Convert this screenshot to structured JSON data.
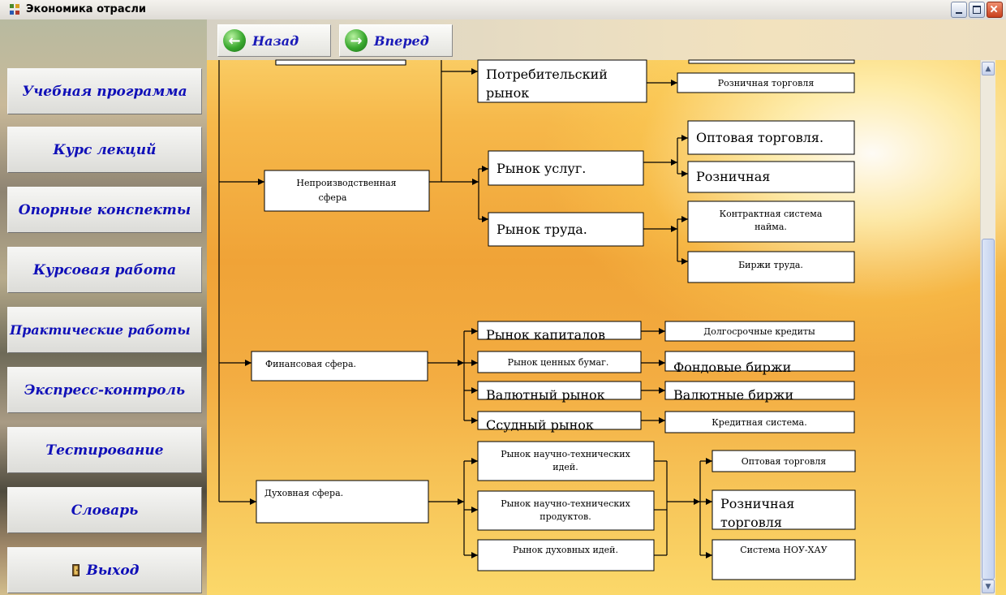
{
  "window": {
    "title": "Экономика отрасли",
    "icon": "app-tree-icon",
    "controls": [
      "minimize",
      "maximize",
      "close"
    ]
  },
  "toolbar": {
    "back_label": "Назад",
    "forward_label": "Вперед"
  },
  "sidebar": {
    "items": [
      {
        "label": "Учебная программа"
      },
      {
        "label": "Курс лекций"
      },
      {
        "label": "Опорные конспекты"
      },
      {
        "label": "Курсовая работа"
      },
      {
        "label": "Практические работы"
      },
      {
        "label": "Экспресс-контроль"
      },
      {
        "label": "Тестирование"
      },
      {
        "label": "Словарь"
      },
      {
        "label": "Выход",
        "icon": "exit-door-icon"
      }
    ]
  },
  "diagram": {
    "nodes": {
      "potreb": [
        "Потребительский",
        "рынок"
      ],
      "rozn_torg_top": "Розничная торговля",
      "neproizv": [
        "Непроизводственная",
        "сфера"
      ],
      "uslug": "Рынок услуг.",
      "opt_torg": "Оптовая торговля.",
      "roznichnaya": "Розничная",
      "truda": "Рынок труда.",
      "kontrakt": [
        "Контрактная система",
        "найма."
      ],
      "birzhi_truda": "Биржи труда.",
      "finans": "Финансовая сфера.",
      "kapitalov": "Рынок капиталов",
      "dolgosroch": "Долгосрочные кредиты",
      "cennyh": "Рынок ценных бумаг.",
      "fondovye": "Фондовые биржи",
      "valutny": "Валютный рынок",
      "valutnye_birzhi": "Валютные биржи",
      "ssudny": "Ссудный рынок",
      "kreditnaya": "Кредитная система.",
      "duhovnaya": "Духовная сфера.",
      "nauch_idei": [
        "Рынок научно-технических",
        "идей."
      ],
      "nauch_prod": [
        "Рынок научно-технических",
        "продуктов."
      ],
      "duh_idei": "Рынок духовных идей.",
      "opt_torg2": "Оптовая торговля",
      "rozn_torg2": [
        "Розничная",
        "торговля"
      ],
      "nou_hau": "Система НОУ-ХАУ"
    }
  },
  "scrollbar": {
    "up_icon": "scroll-up-arrow-icon",
    "down_icon": "scroll-down-arrow-icon"
  }
}
